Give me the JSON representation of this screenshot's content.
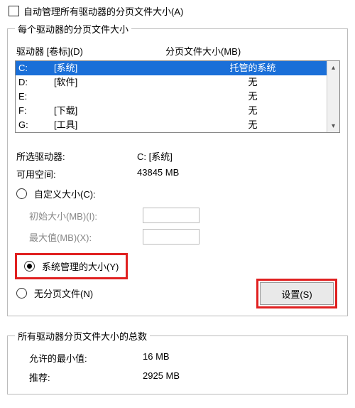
{
  "auto_manage": {
    "label": "自动管理所有驱动器的分页文件大小(A)",
    "checked": false
  },
  "group1": {
    "legend": "每个驱动器的分页文件大小",
    "header_drive": "驱动器  [卷标](D)",
    "header_size": "分页文件大小(MB)",
    "drives": [
      {
        "letter": "C:",
        "label": "[系统]",
        "size": "托管的系统",
        "selected": true
      },
      {
        "letter": "D:",
        "label": "[软件]",
        "size": "无",
        "selected": false
      },
      {
        "letter": "E:",
        "label": "",
        "size": "无",
        "selected": false
      },
      {
        "letter": "F:",
        "label": "[下载]",
        "size": "无",
        "selected": false
      },
      {
        "letter": "G:",
        "label": "[工具]",
        "size": "无",
        "selected": false
      }
    ],
    "selected_drive_label": "所选驱动器:",
    "selected_drive_value": "C:  [系统]",
    "free_space_label": "可用空间:",
    "free_space_value": "43845 MB",
    "radio_custom": "自定义大小(C):",
    "initial_size_label": "初始大小(MB)(I):",
    "max_size_label": "最大值(MB)(X):",
    "radio_system": "系统管理的大小(Y)",
    "radio_none": "无分页文件(N)",
    "set_button": "设置(S)",
    "scroll_up": "▴",
    "scroll_down": "▾"
  },
  "group2": {
    "legend": "所有驱动器分页文件大小的总数",
    "min_allowed_label": "允许的最小值:",
    "min_allowed_value": "16 MB",
    "recommended_label": "推荐:",
    "recommended_value": "2925 MB"
  }
}
